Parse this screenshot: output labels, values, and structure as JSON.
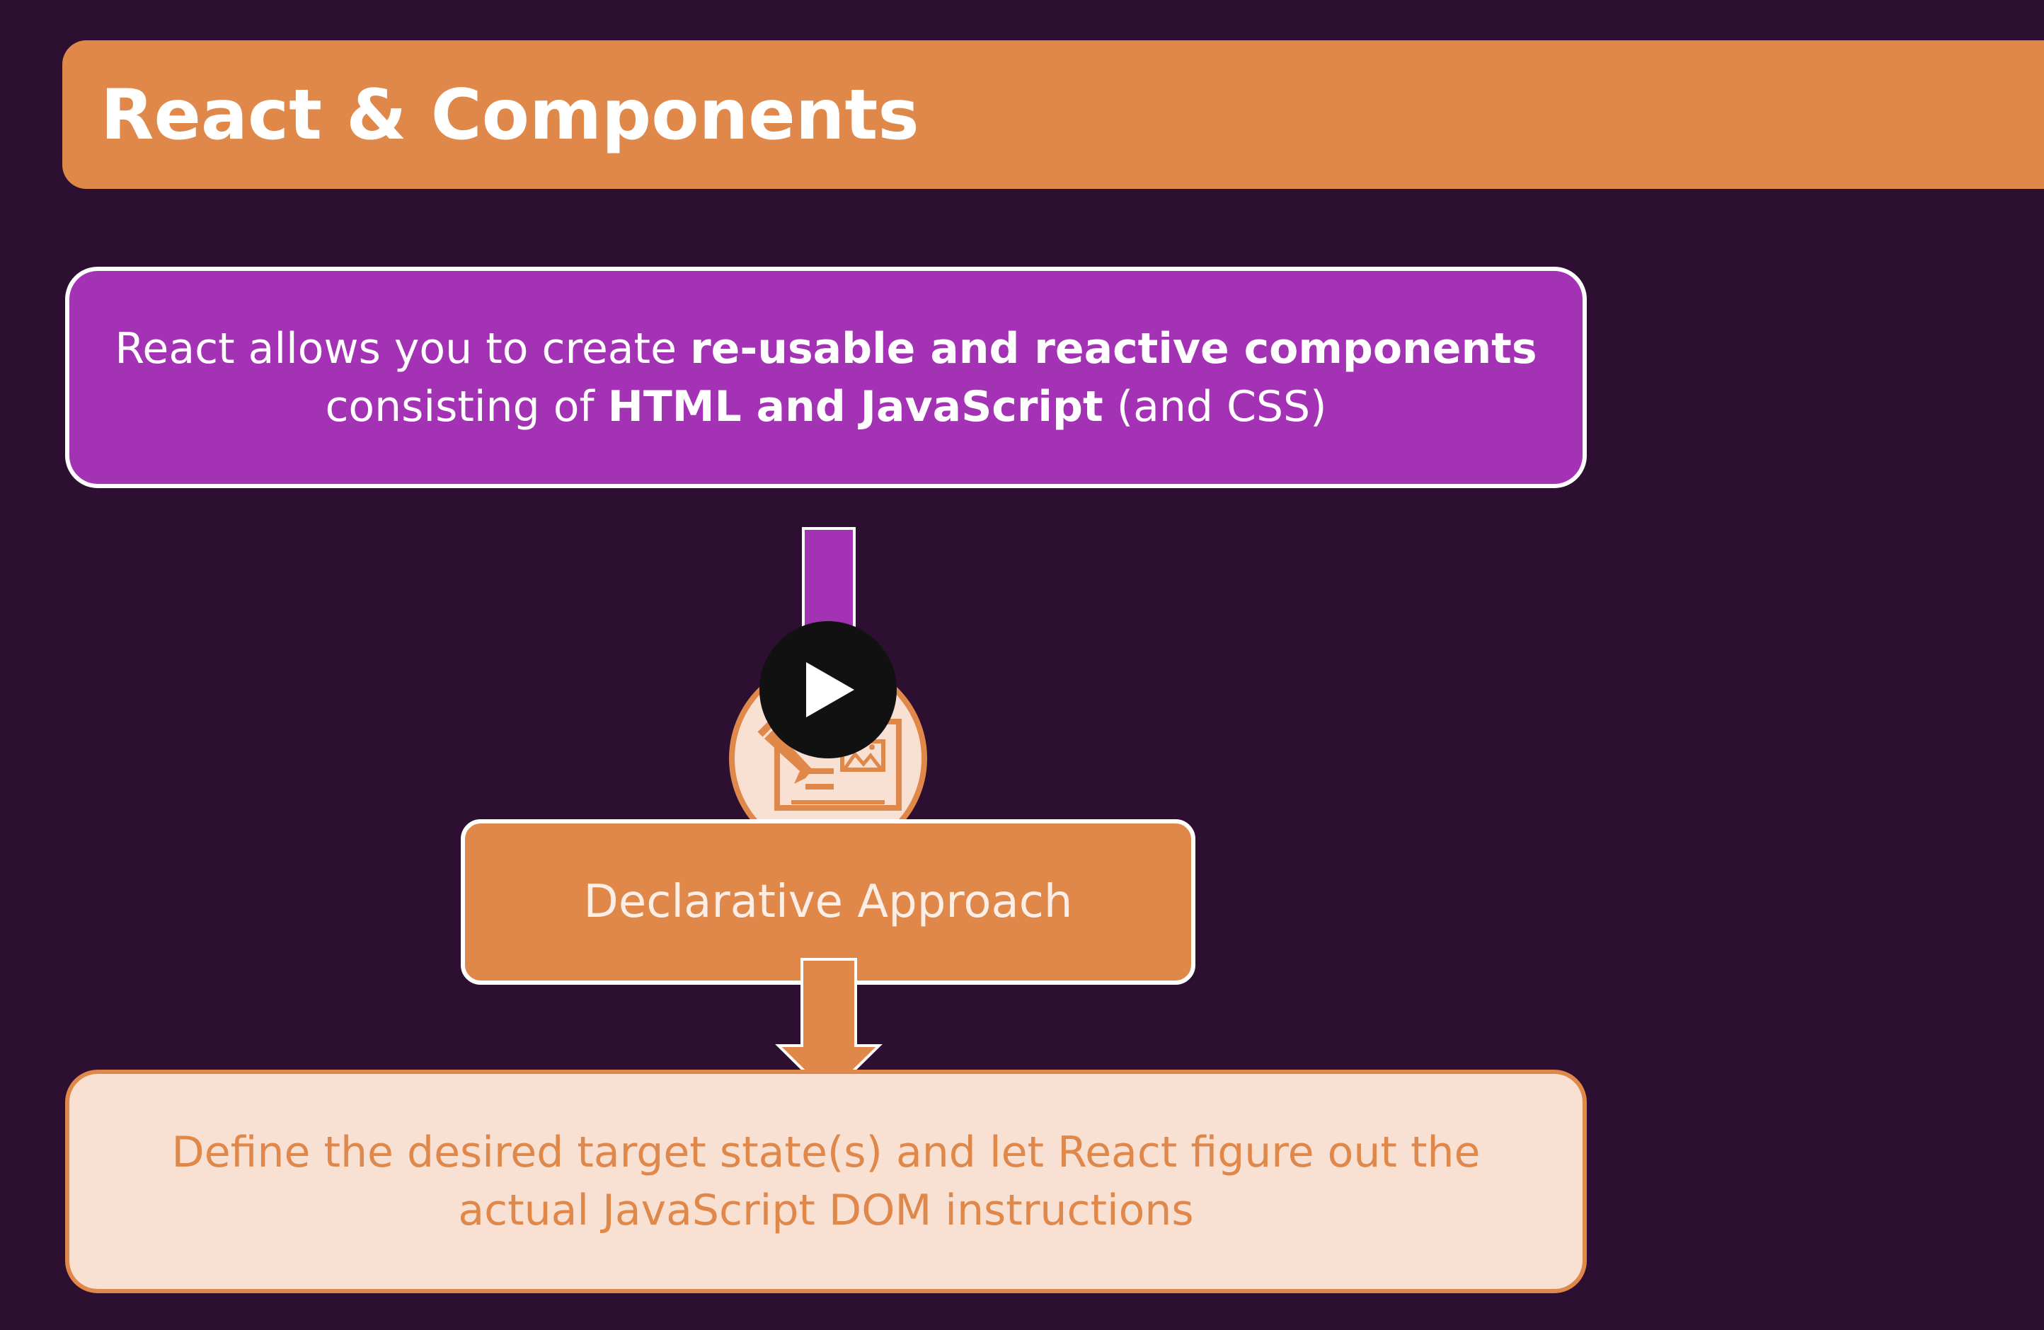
{
  "slide": {
    "title": "React & Components",
    "top_box": {
      "line1_normal": "React allows you to create ",
      "line1_bold": "re-usable and reactive components",
      "line2_normal_a": "consisting of ",
      "line2_bold": "HTML and JavaScript",
      "line2_normal_b": " (and CSS)"
    },
    "middle_box": {
      "label": "Declarative Approach",
      "icon": "document-edit-icon"
    },
    "bottom_box": {
      "line1": "Define the desired target state(s) and let React figure out the",
      "line2": "actual JavaScript DOM instructions"
    }
  },
  "player": {
    "play_icon": "play-icon"
  },
  "colors": {
    "background": "#2d0f31",
    "accent_orange": "#e0874a",
    "accent_purple": "#a333b4",
    "peach": "#f8e0d3",
    "white": "#ffffff"
  }
}
